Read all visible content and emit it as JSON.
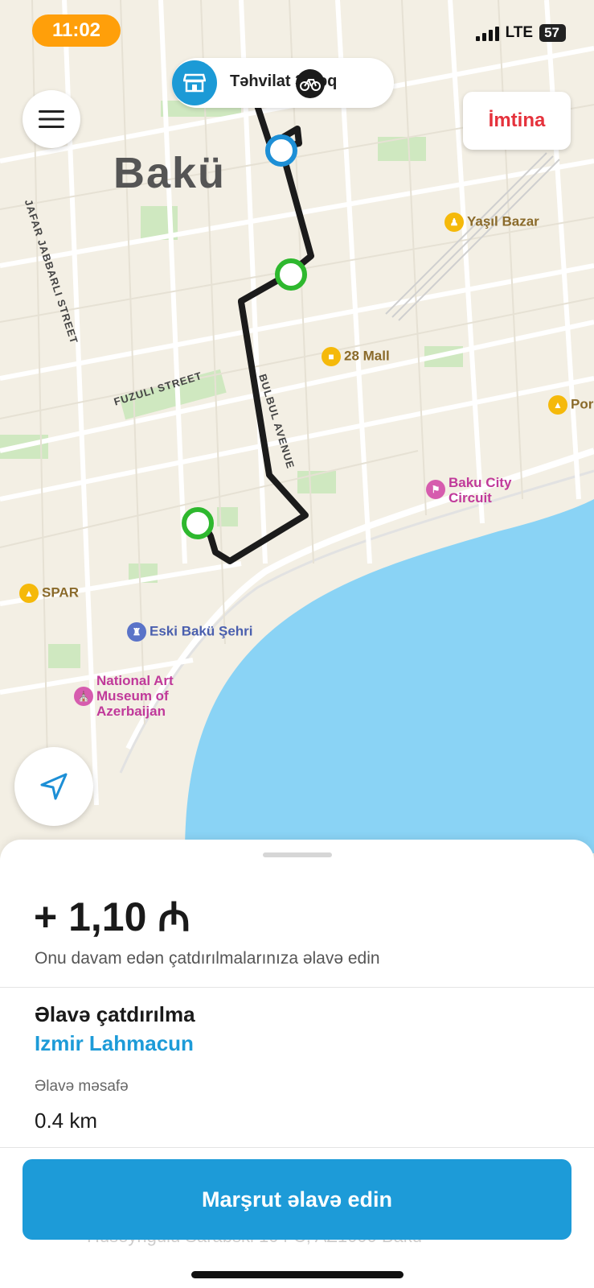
{
  "status_bar": {
    "time": "11:02",
    "network": "LTE",
    "battery": "57"
  },
  "map": {
    "city_label": "Bakü",
    "streets": [
      "JAFAR JABBARLI STREET",
      "FUZULI STREET",
      "BULBUL AVENUE"
    ],
    "pois": [
      {
        "label": "Yaşıl Bazar",
        "icon": "shopping-bag-icon"
      },
      {
        "label": "28 Mall",
        "icon": "mall-icon"
      },
      {
        "label": "Por",
        "icon": "shopping-cart-icon"
      },
      {
        "label": "Baku City Circuit",
        "icon": "race-flag-icon"
      },
      {
        "label": "SPAR",
        "icon": "shopping-cart-icon"
      },
      {
        "label": "Eski Bakü Şehri",
        "icon": "landmark-icon"
      },
      {
        "label": "National Art Museum of Azerbaijan",
        "icon": "museum-icon"
      }
    ],
    "delivery_pill": {
      "text": "Təhvilat 3 dəq"
    },
    "cancel_label": "İmtina",
    "colors": {
      "route": "#1b1b1b",
      "pickup": "#2eb82e",
      "dropoff": "#1d8fd6",
      "water": "#8ad3f5",
      "cancel": "#e5323c"
    }
  },
  "sheet": {
    "price": "+ 1,10 ₼",
    "subtitle": "Onu davam edən çatdırılmalarınıza əlavə edin",
    "extra_title": "Əlavə çatdırılma",
    "restaurant": "Izmir Lahmacun",
    "distance_label": "Əlavə məsafə",
    "distance_value": "0.4 km",
    "address_partial": "Huseyngulu Sarabski 104 C, AZ1000 Baku",
    "cta_label": "Marşrut əlavə edin"
  }
}
